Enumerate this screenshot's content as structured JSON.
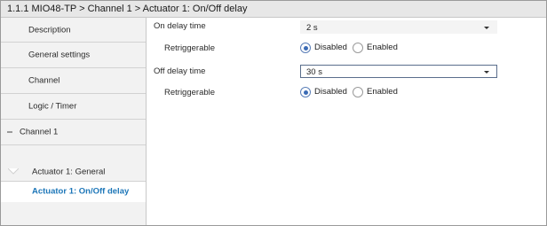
{
  "breadcrumb": "1.1.1 MIO48-TP > Channel 1 > Actuator 1: On/Off delay",
  "sidebar": {
    "items": [
      {
        "label": "Description"
      },
      {
        "label": "General settings"
      },
      {
        "label": "Channel"
      },
      {
        "label": "Logic / Timer"
      }
    ],
    "group": {
      "label": "Channel 1",
      "toggle_icon": "collapse-minus-icon"
    },
    "children": [
      {
        "label": "Actuator 1: General"
      },
      {
        "label": "Actuator 1: On/Off delay",
        "active": true
      }
    ]
  },
  "params": {
    "on_delay": {
      "label": "On delay time",
      "value": "2 s"
    },
    "on_retrig": {
      "label": "Retriggerable",
      "options": [
        "Disabled",
        "Enabled"
      ],
      "selected": "Disabled"
    },
    "off_delay": {
      "label": "Off delay time",
      "value": "30 s"
    },
    "off_retrig": {
      "label": "Retriggerable",
      "options": [
        "Disabled",
        "Enabled"
      ],
      "selected": "Disabled"
    }
  },
  "colors": {
    "active_nav_text": "#1c76b8",
    "radio_selected": "#3b6bb5",
    "sidebar_bg": "#f2f2f2",
    "title_bg": "#e7e7e7"
  }
}
